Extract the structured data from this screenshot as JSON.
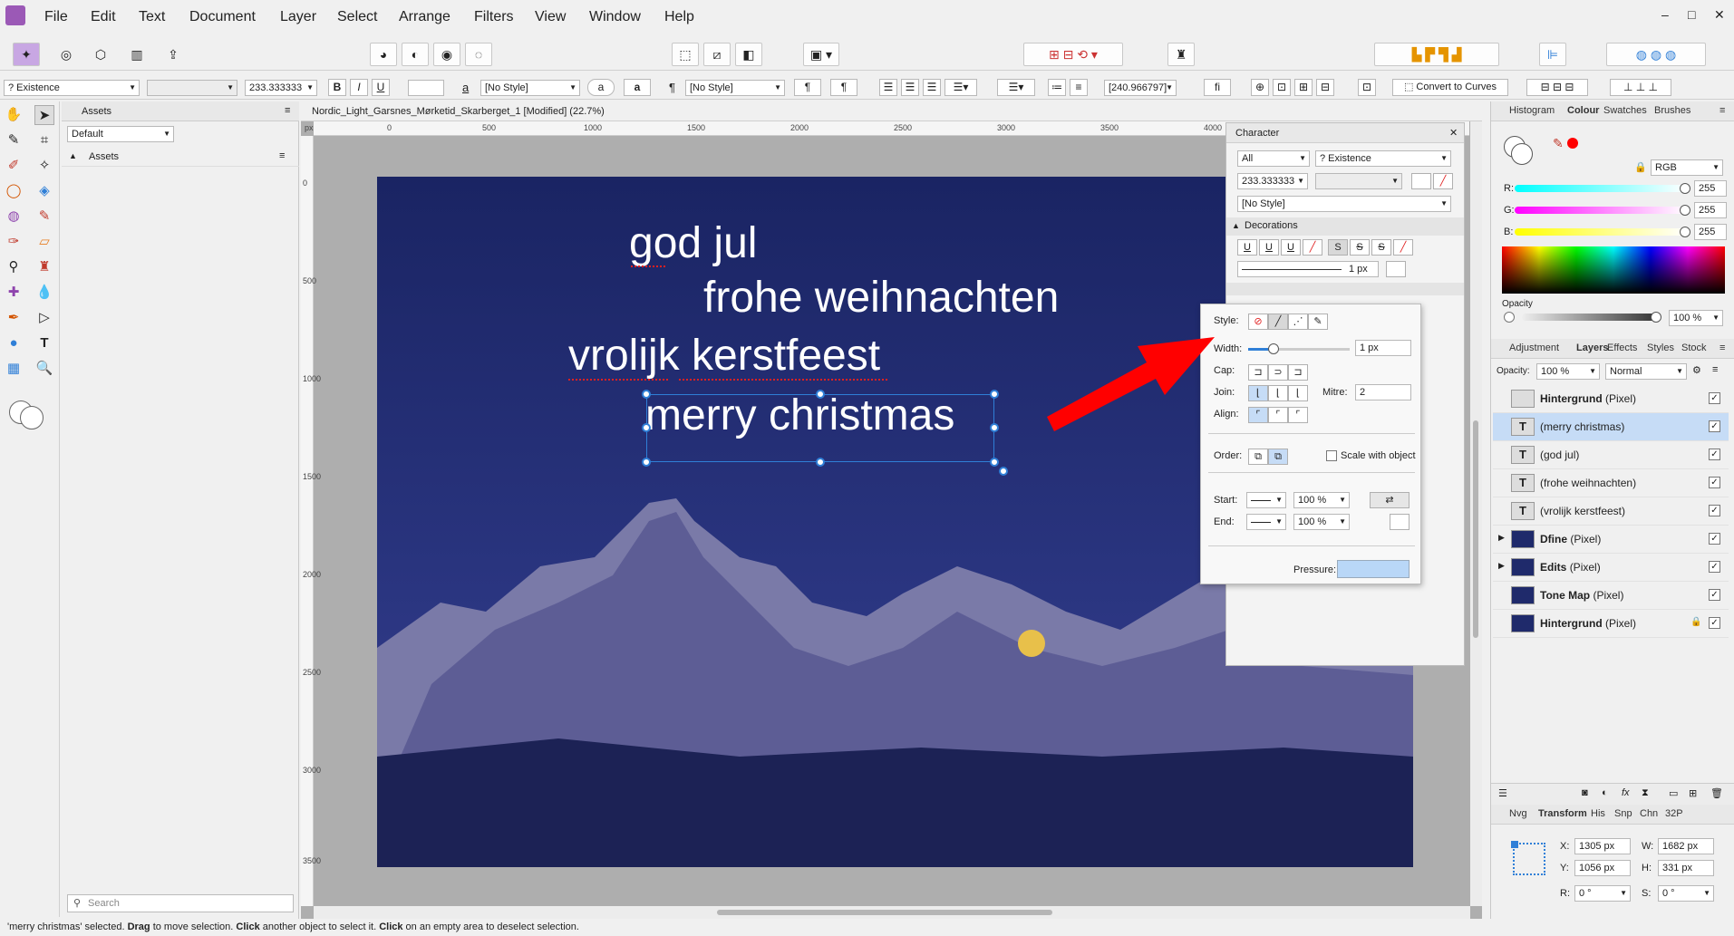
{
  "menubar": {
    "items": [
      "File",
      "Edit",
      "Text",
      "Document",
      "Layer",
      "Select",
      "Arrange",
      "Filters",
      "View",
      "Window",
      "Help"
    ],
    "window_controls": [
      "‒",
      "□",
      "✕"
    ]
  },
  "context_toolbar": {
    "font_family": "? Existence",
    "font_style": "",
    "font_size": "233.333333",
    "bold": "B",
    "italic": "I",
    "underline": "U",
    "char_style": "[No Style]",
    "para_style": "[No Style]",
    "pilcrow": "¶",
    "letter_a": "a",
    "a_glyph": "a",
    "leading_value": "[240.966797]",
    "fi_glyph": "fi",
    "convert_to_curves": "Convert to Curves"
  },
  "assets": {
    "tab": "Assets",
    "dropdown": "Default",
    "section": "Assets",
    "search_placeholder": "Search"
  },
  "document": {
    "tab_title": "Nordic_Light_Garsnes_Mørketid_Skarberget_1 [Modified] (22.7%)",
    "ruler_h_labels": [
      "px",
      "0",
      "500",
      "1000",
      "1500",
      "2000",
      "2500",
      "3000",
      "3500",
      "4000"
    ],
    "ruler_v_labels": [
      "0",
      "500",
      "1000",
      "1500",
      "2000",
      "2500",
      "3000",
      "3500"
    ],
    "canvas_texts": [
      "god jul",
      "frohe weihnachten",
      "vrolijk kerstfeest",
      "merry christmas"
    ]
  },
  "character_panel": {
    "title": "Character",
    "language": "All",
    "font_family": "? Existence",
    "size": "233.333333",
    "style": "[No Style]",
    "decorations_label": "Decorations",
    "line_width_value": "1 px",
    "u1": "U",
    "u2": "U",
    "u3": "U",
    "s1": "S",
    "s2": "S",
    "s3": "S"
  },
  "stroke_popup": {
    "style_label": "Style:",
    "width_label": "Width:",
    "width_value": "1 px",
    "width_fraction": 0.25,
    "cap_label": "Cap:",
    "join_label": "Join:",
    "mitre_label": "Mitre:",
    "mitre_value": "2",
    "align_label": "Align:",
    "order_label": "Order:",
    "scale_label": "Scale with object",
    "start_label": "Start:",
    "start_pct": "100 %",
    "end_label": "End:",
    "end_pct": "100 %",
    "pressure_label": "Pressure:"
  },
  "right_panel": {
    "top_tabs": [
      "Histogram",
      "Colour",
      "Swatches",
      "Brushes"
    ],
    "color_model": "RGB",
    "r_label": "R:",
    "r_value": "255",
    "g_label": "G:",
    "g_value": "255",
    "b_label": "B:",
    "b_value": "255",
    "opacity_label": "Opacity",
    "opacity_value": "100 %",
    "mid_tabs": [
      "Adjustment",
      "Layers",
      "Effects",
      "Styles",
      "Stock"
    ],
    "layers_opacity_label": "Opacity:",
    "layers_opacity_value": "100 %",
    "blend_mode": "Normal",
    "layers": [
      {
        "name": "Hintergrund",
        "type": "(Pixel)",
        "kind": "blank",
        "selected": false
      },
      {
        "name": "",
        "type": "(merry christmas)",
        "kind": "text",
        "selected": true
      },
      {
        "name": "",
        "type": "(god jul)",
        "kind": "text",
        "selected": false
      },
      {
        "name": "",
        "type": "(frohe weihnachten)",
        "kind": "text",
        "selected": false
      },
      {
        "name": "",
        "type": "(vrolijk kerstfeest)",
        "kind": "text",
        "selected": false
      },
      {
        "name": "Dfine",
        "type": "(Pixel)",
        "kind": "pixel",
        "selected": false
      },
      {
        "name": "Edits",
        "type": "(Pixel)",
        "kind": "pixel",
        "selected": false
      },
      {
        "name": "Tone Map",
        "type": "(Pixel)",
        "kind": "pixel",
        "selected": false
      },
      {
        "name": "Hintergrund",
        "type": "(Pixel)",
        "kind": "pixel",
        "selected": false
      }
    ],
    "bottom_tabs": [
      "Nvg",
      "Transform",
      "His",
      "Snp",
      "Chn",
      "32P"
    ],
    "x_label": "X:",
    "x_value": "1305 px",
    "y_label": "Y:",
    "y_value": "1056 px",
    "w_label": "W:",
    "w_value": "1682 px",
    "h_label": "H:",
    "h_value": "331 px",
    "r_rot_label": "R:",
    "r_rot_value": "0 °",
    "s_label": "S:",
    "s_value": "0 °"
  },
  "status": {
    "quote": "'merry christmas'",
    "t1": " selected. ",
    "drag": "Drag",
    "t2": " to move selection. ",
    "click1": "Click",
    "t3": " another object to select it. ",
    "click2": "Click",
    "t4": " on an empty area to deselect selection."
  },
  "colors": {
    "accent": "#2f7fd7",
    "selected_row": "#c6dcf6",
    "arrow": "#ff0000",
    "sky": "#1f2a6b"
  }
}
